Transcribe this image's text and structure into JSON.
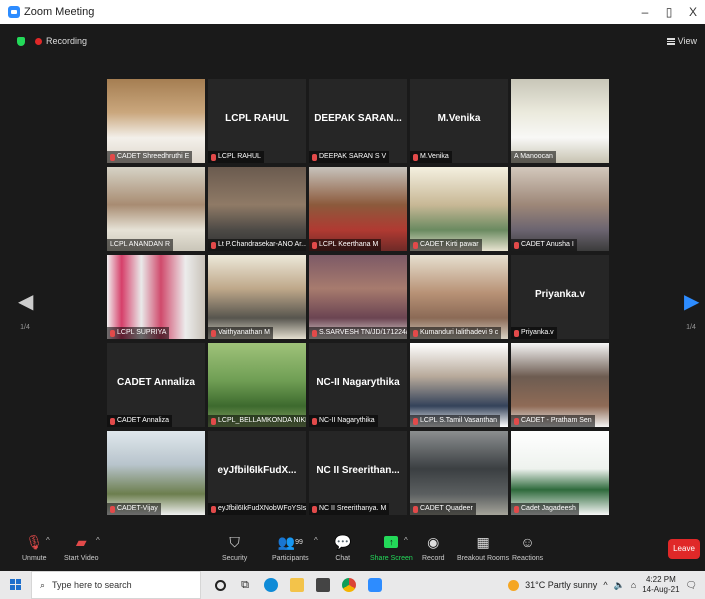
{
  "window": {
    "title": "Zoom Meeting",
    "minimize": "–",
    "maximize": "▯",
    "close": "X"
  },
  "meeting": {
    "recording_label": "Recording",
    "view_label": "View",
    "page_left": "1/4",
    "page_right": "1/4"
  },
  "tiles": [
    {
      "caption": "CADET Shreedhruthi E",
      "bigname": "",
      "muted": true
    },
    {
      "caption": "LCPL RAHUL",
      "bigname": "LCPL RAHUL",
      "muted": true
    },
    {
      "caption": "DEEPAK SARAN S V",
      "bigname": "DEEPAK SARAN...",
      "muted": true
    },
    {
      "caption": "M.Venika",
      "bigname": "M.Venika",
      "muted": true
    },
    {
      "caption": "A Manoocan",
      "bigname": "",
      "muted": false
    },
    {
      "caption": "LCPL ANANDAN R",
      "bigname": "",
      "muted": false
    },
    {
      "caption": "Lt P.Chandrasekar-ANO Ar...",
      "bigname": "",
      "muted": true
    },
    {
      "caption": "LCPL Keerthana M",
      "bigname": "",
      "muted": true
    },
    {
      "caption": "CADET Kirti pawar",
      "bigname": "",
      "muted": true
    },
    {
      "caption": "CADET Anusha I",
      "bigname": "",
      "muted": true
    },
    {
      "caption": "LCPL SUPRIYA",
      "bigname": "",
      "muted": true
    },
    {
      "caption": "Vaithyanathan M",
      "bigname": "",
      "muted": true
    },
    {
      "caption": "S.SARVESH TN/JD/171224/...",
      "bigname": "",
      "muted": true
    },
    {
      "caption": "Kumanduri lalithadevi 9 c",
      "bigname": "",
      "muted": true
    },
    {
      "caption": "Priyanka.v",
      "bigname": "Priyanka.v",
      "muted": true
    },
    {
      "caption": "CADET Annaliza",
      "bigname": "CADET Annaliza",
      "muted": true
    },
    {
      "caption": "LCPL_BELLAMKONDA NIKH...",
      "bigname": "",
      "muted": true
    },
    {
      "caption": "NC-II Nagarythika",
      "bigname": "NC-II Nagarythika",
      "muted": true
    },
    {
      "caption": "LCPL S.Tamil Vasanthan",
      "bigname": "",
      "muted": true
    },
    {
      "caption": "CADET - Pratham Sen",
      "bigname": "",
      "muted": true
    },
    {
      "caption": "CADET-Vijay",
      "bigname": "",
      "muted": true
    },
    {
      "caption": "eyJfbil6IkFudXNobWFoYSIs...",
      "bigname": "eyJfbil6IkFudX...",
      "muted": true
    },
    {
      "caption": "NC II Sreerithanya. M",
      "bigname": "NC II Sreerithan...",
      "muted": true
    },
    {
      "caption": "CADET Quadeer",
      "bigname": "",
      "muted": true
    },
    {
      "caption": "Cadet Jagadeesh",
      "bigname": "",
      "muted": true
    }
  ],
  "toolbar": {
    "unmute": "Unmute",
    "start_video": "Start Video",
    "security": "Security",
    "participants": "Participants",
    "participants_count": "99",
    "chat": "Chat",
    "share_screen": "Share Screen",
    "record": "Record",
    "breakout_rooms": "Breakout Rooms",
    "reactions": "Reactions",
    "leave": "Leave"
  },
  "taskbar": {
    "search_placeholder": "Type here to search",
    "weather": "31°C  Partly sunny",
    "time": "4:22 PM",
    "date": "14-Aug-21"
  }
}
